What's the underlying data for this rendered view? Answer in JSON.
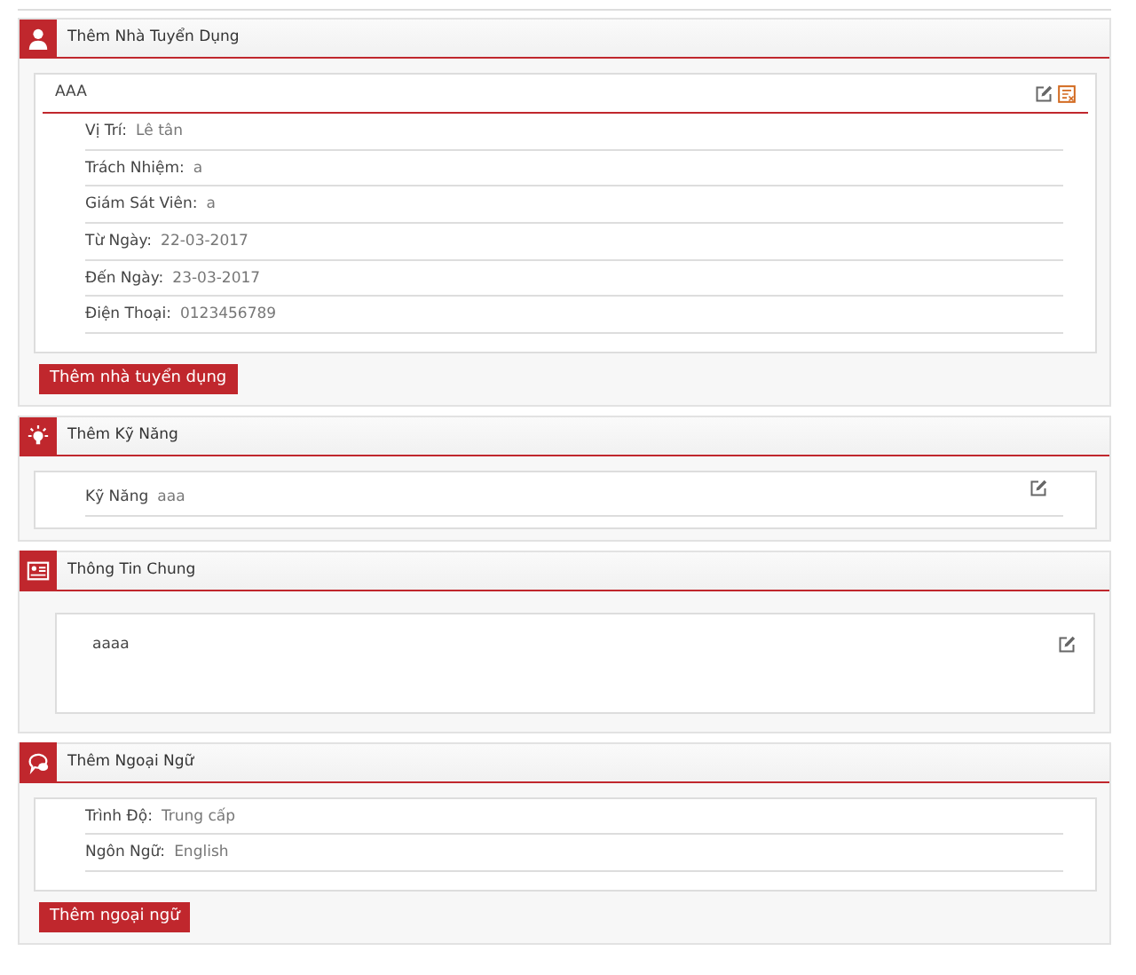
{
  "sections": [
    {
      "kind": "employer",
      "title": "Thêm Nhà Tuyển Dụng",
      "entries": [
        {
          "title": "AAA",
          "edit": true,
          "delete": true,
          "fields": [
            {
              "label": "Vị Trí:",
              "value": "Lê tân"
            },
            {
              "label": "Trách Nhiệm:",
              "value": "a"
            },
            {
              "label": "Giám Sát Viên:",
              "value": "a"
            },
            {
              "label": "Từ Ngày:",
              "value": "22-03-2017"
            },
            {
              "label": "Đến Ngày:",
              "value": "23-03-2017"
            },
            {
              "label": "Điện Thoại:",
              "value": "0123456789"
            }
          ]
        }
      ],
      "button": "Thêm nhà tuyển dụng"
    },
    {
      "kind": "skill",
      "title": "Thêm Kỹ Năng",
      "entries": [
        {
          "edit": true,
          "delete": false,
          "fields": [
            {
              "label": "Kỹ Năng",
              "value": "aaa"
            }
          ]
        }
      ]
    },
    {
      "kind": "general",
      "title": "Thông Tin Chung",
      "entries": [
        {
          "edit": true,
          "delete": false,
          "text": "aaaa"
        }
      ]
    },
    {
      "kind": "language",
      "title": "Thêm Ngoại Ngữ",
      "entries": [
        {
          "edit": false,
          "delete": false,
          "fields": [
            {
              "label": "Trình Độ:",
              "value": "Trung cấp"
            },
            {
              "label": "Ngôn Ngữ:",
              "value": "English"
            }
          ]
        }
      ],
      "button": "Thêm ngoại ngữ"
    }
  ]
}
